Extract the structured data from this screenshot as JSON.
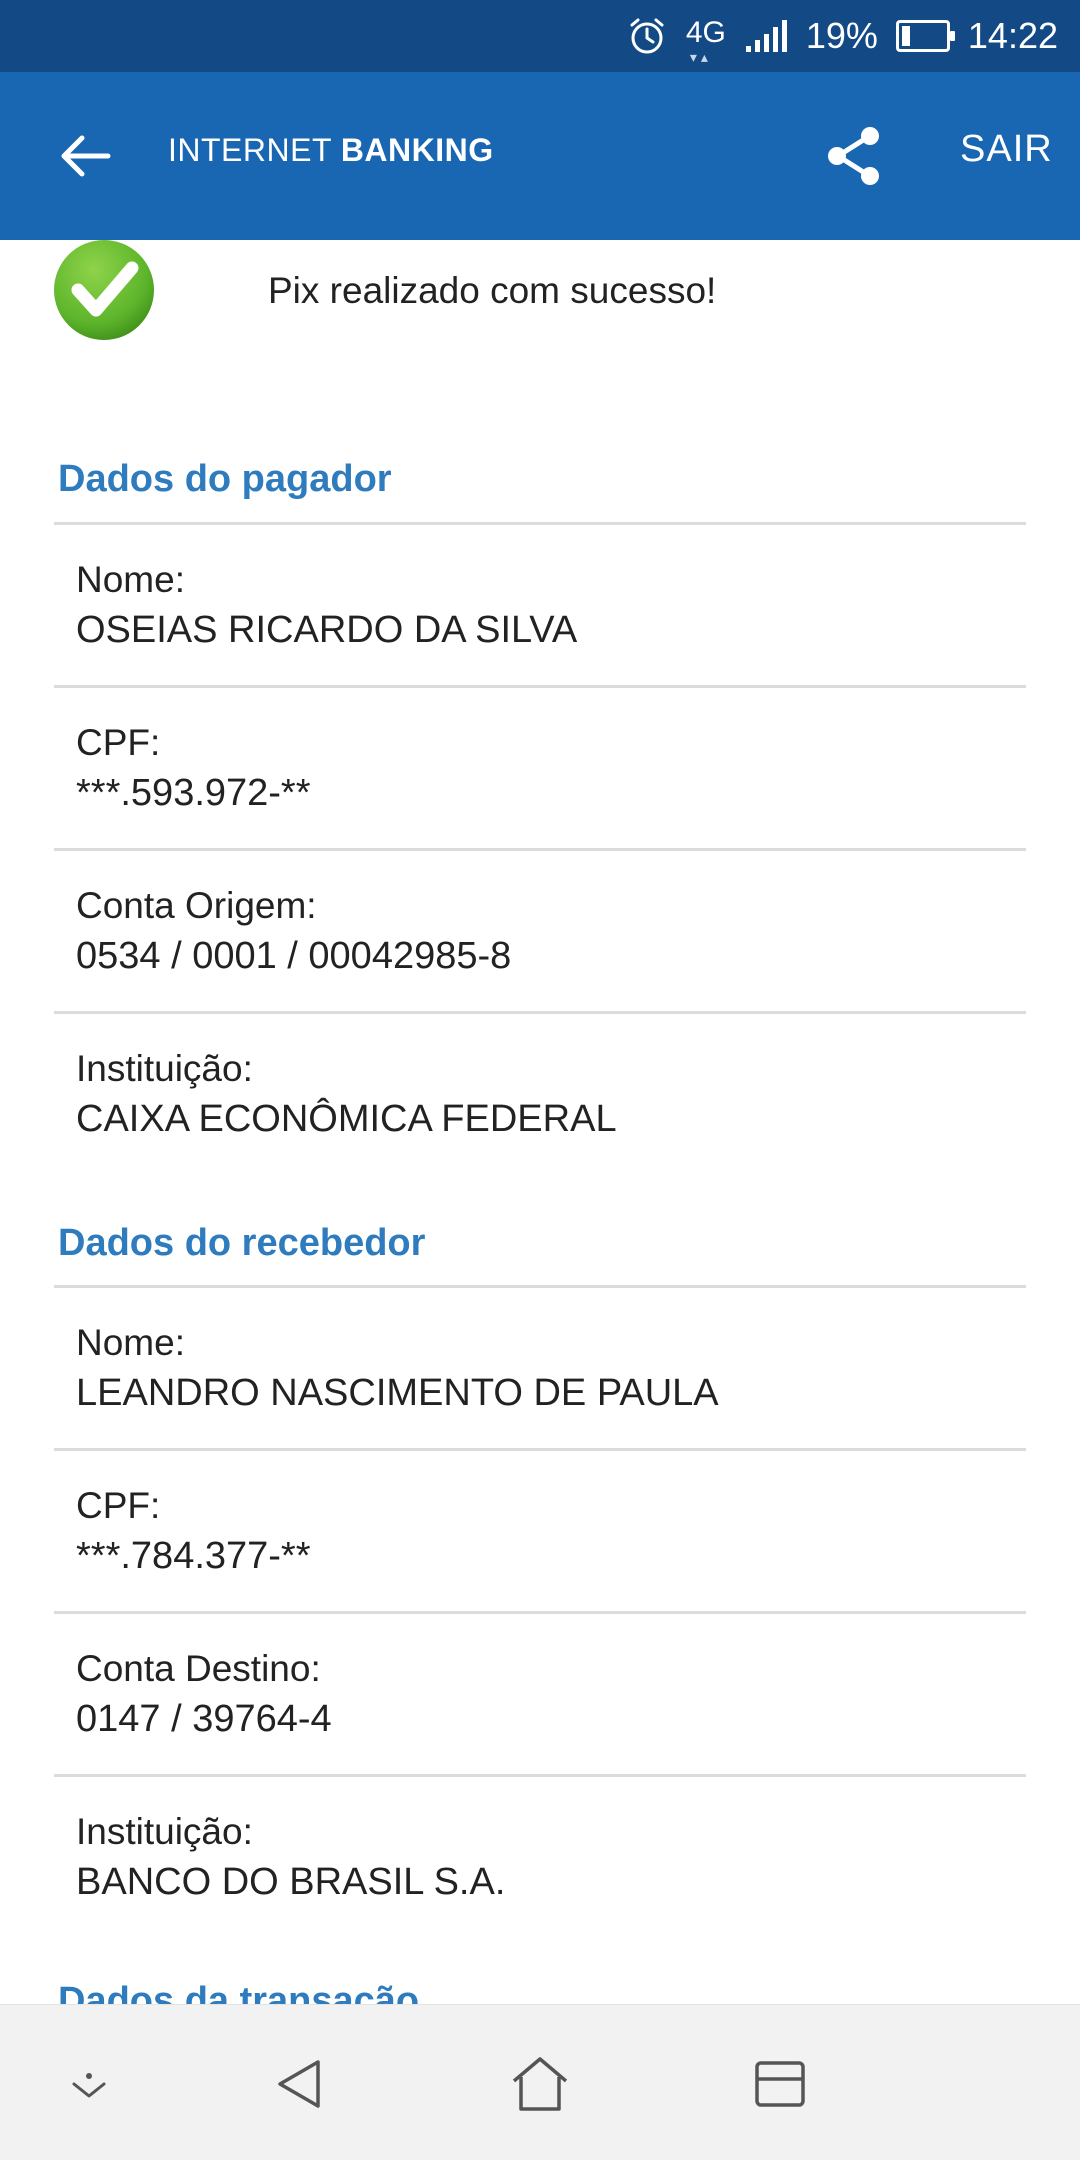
{
  "status_bar": {
    "network": "4G",
    "battery_percent": "19%",
    "battery_level": 0.19,
    "time": "14:22",
    "icons": [
      "alarm-icon",
      "signal-icon",
      "battery-icon"
    ]
  },
  "header": {
    "brand_light": "INTERNET",
    "brand_bold": "BANKING",
    "exit_label": "SAIR",
    "colors": {
      "status_bar": "#134a86",
      "app_bar": "#1966b2"
    }
  },
  "success": {
    "message": "Pix realizado com sucesso!",
    "icon": "check-icon",
    "icon_color": "#5db52b"
  },
  "payer": {
    "title": "Dados do pagador",
    "fields": [
      {
        "label": "Nome:",
        "value": "OSEIAS RICARDO DA SILVA"
      },
      {
        "label": "CPF:",
        "value": "***.593.972-**"
      },
      {
        "label": "Conta Origem:",
        "value": "0534 / 0001 / 00042985-8"
      },
      {
        "label": "Instituição:",
        "value": "CAIXA ECONÔMICA FEDERAL"
      }
    ]
  },
  "receiver": {
    "title": "Dados do recebedor",
    "fields": [
      {
        "label": "Nome:",
        "value": "LEANDRO NASCIMENTO DE PAULA"
      },
      {
        "label": "CPF:",
        "value": "***.784.377-**"
      },
      {
        "label": "Conta Destino:",
        "value": "0147 / 39764-4"
      },
      {
        "label": "Instituição:",
        "value": "BANCO DO BRASIL S.A."
      }
    ]
  },
  "transaction": {
    "title": "Dados da transação"
  },
  "section_color": "#2e7bbd"
}
